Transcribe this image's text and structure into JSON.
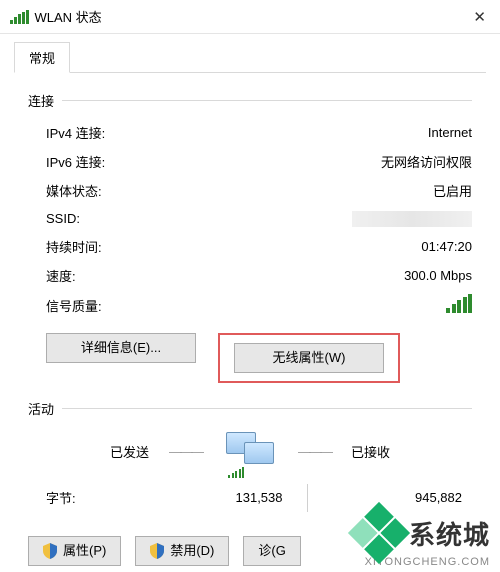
{
  "window": {
    "title": "WLAN 状态",
    "close_glyph": "✕"
  },
  "tabs": {
    "general": "常规"
  },
  "groups": {
    "connection": "连接",
    "activity": "活动"
  },
  "connection": {
    "ipv4_label": "IPv4 连接:",
    "ipv4_value": "Internet",
    "ipv6_label": "IPv6 连接:",
    "ipv6_value": "无网络访问权限",
    "media_label": "媒体状态:",
    "media_value": "已启用",
    "ssid_label": "SSID:",
    "duration_label": "持续时间:",
    "duration_value": "01:47:20",
    "speed_label": "速度:",
    "speed_value": "300.0 Mbps",
    "quality_label": "信号质量:"
  },
  "buttons": {
    "details": "详细信息(E)...",
    "wireless_props": "无线属性(W)",
    "properties": "属性(P)",
    "disable": "禁用(D)",
    "diagnose_partial": "诊(G"
  },
  "activity": {
    "sent_label": "已发送",
    "received_label": "已接收",
    "dash": "———",
    "bytes_label": "字节:",
    "sent_value": "131,538",
    "received_value": "945,882"
  },
  "watermark": {
    "text": "系统城",
    "sub": "XITONGCHENG.COM"
  }
}
